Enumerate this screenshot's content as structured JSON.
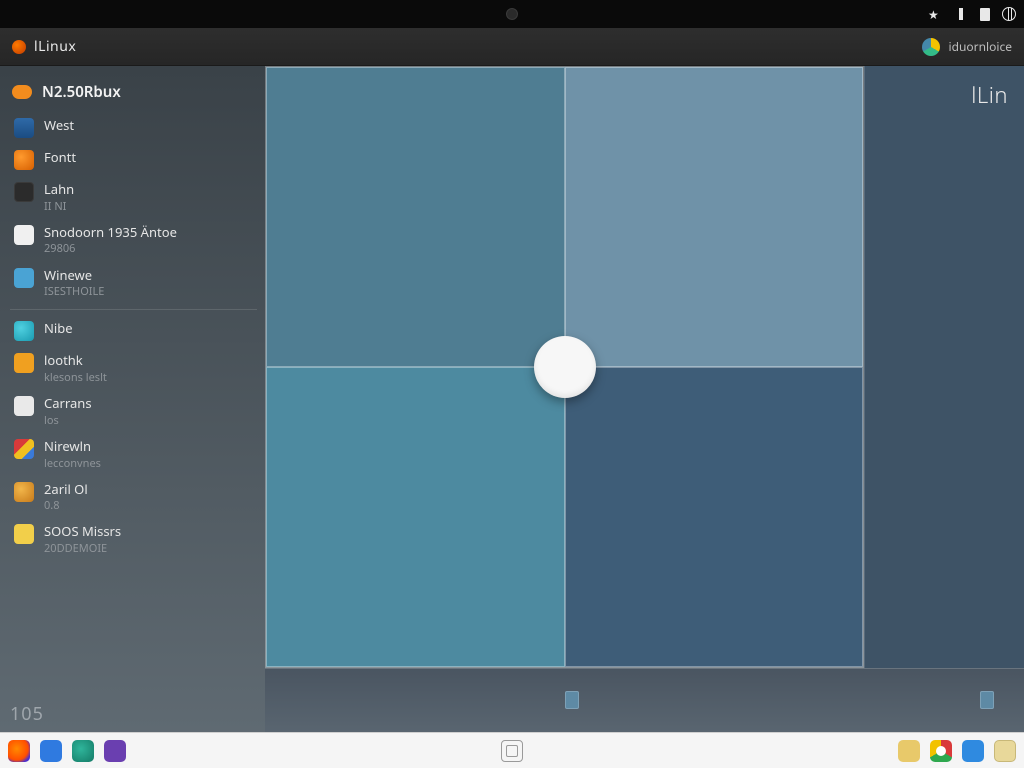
{
  "topbar": {
    "tray": [
      "star-icon",
      "bar-icon",
      "file-icon",
      "globe-icon"
    ]
  },
  "header": {
    "title": "lLinux",
    "user_label": "iduornloice"
  },
  "sidebar": {
    "section_title": "N2.50Rbux",
    "items": [
      {
        "icon": "ic-blue",
        "line1": "West",
        "line2": ""
      },
      {
        "icon": "ic-orange",
        "line1": "Fontt",
        "line2": ""
      },
      {
        "icon": "ic-dark",
        "line1": "Lahn",
        "line2": "II NI"
      },
      {
        "icon": "ic-white",
        "line1": "Snodoorn 1935 Äntoe",
        "line2": "29806"
      },
      {
        "icon": "ic-skyb",
        "line1": "Winewe",
        "line2": "ISESTHOILE"
      },
      {
        "icon": "ic-cyan",
        "line1": "Nibe",
        "line2": ""
      },
      {
        "icon": "ic-amber",
        "line1": "loothk",
        "line2": "klesons leslt"
      },
      {
        "icon": "ic-cloud",
        "line1": "Carrans",
        "line2": "los"
      },
      {
        "icon": "ic-multi",
        "line1": "Nirewln",
        "line2": "lecconvnes"
      },
      {
        "icon": "ic-gold",
        "line1": "2aril Ol",
        "line2": "0.8"
      },
      {
        "icon": "ic-yell",
        "line1": "SOOS Missrs",
        "line2": "20DDEMOIE"
      }
    ],
    "footer": "105"
  },
  "workspace": {
    "brand": "lLin",
    "quadrants": {
      "q1": "#4f7d92",
      "q2": "#6f92a8",
      "q3": "#4d8aa0",
      "q4": "#3e5d78"
    }
  },
  "taskbar": {
    "left": [
      "firefox",
      "files",
      "terminal",
      "apps"
    ],
    "right": [
      "folder",
      "chrome",
      "store",
      "notes"
    ]
  }
}
